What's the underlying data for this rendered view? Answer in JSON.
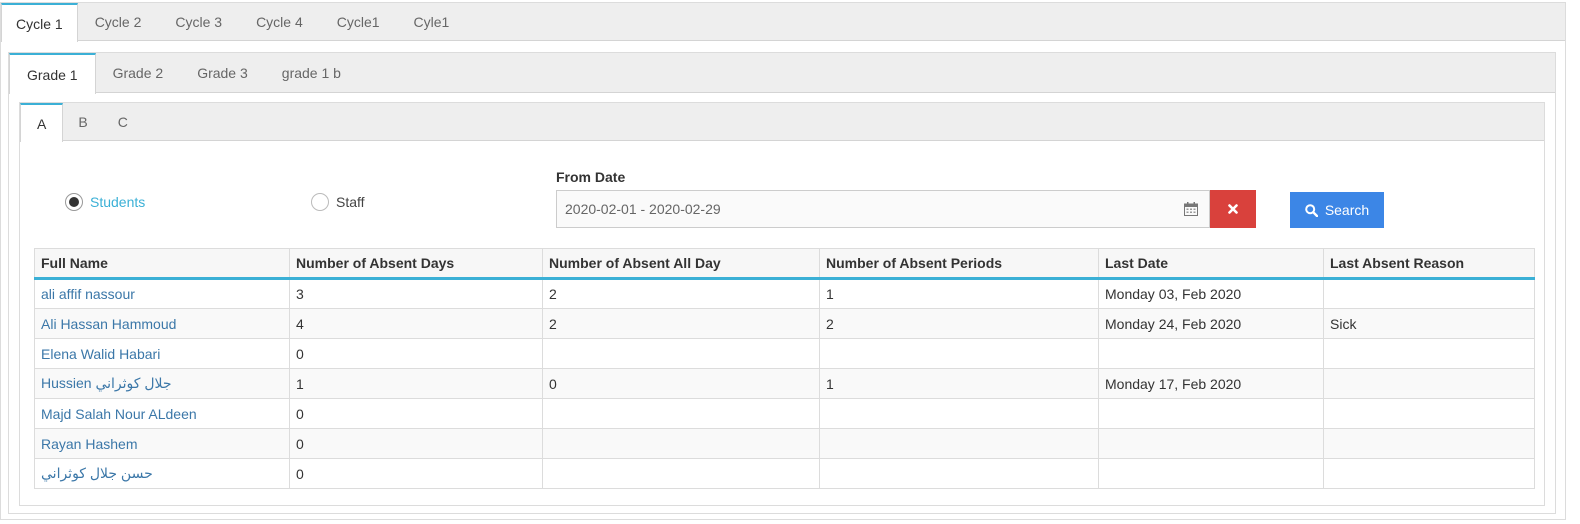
{
  "cycle_tabs": [
    "Cycle 1",
    "Cycle 2",
    "Cycle 3",
    "Cycle 4",
    "Cycle1",
    "Cyle1"
  ],
  "grade_tabs": [
    "Grade 1",
    "Grade 2",
    "Grade 3",
    "grade 1 b"
  ],
  "section_tabs": [
    "A",
    "B",
    "C"
  ],
  "filters": {
    "students_label": "Students",
    "staff_label": "Staff",
    "selected": "Students",
    "from_date_label": "From Date",
    "date_range": "2020-02-01 - 2020-02-29",
    "search_label": "Search"
  },
  "colors": {
    "accent": "#3bb0d6",
    "clear_button": "#d9413c",
    "search_button": "#3c86e6",
    "link": "#3b77a8"
  },
  "icons": {
    "calendar": "calendar-icon",
    "clear": "times-icon",
    "search": "magnifier-icon"
  },
  "table": {
    "headers": [
      "Full Name",
      "Number of Absent Days",
      "Number of Absent All Day",
      "Number of Absent Periods",
      "Last Date",
      "Last Absent Reason"
    ],
    "rows": [
      [
        "ali affif nassour",
        "3",
        "2",
        "1",
        "Monday 03, Feb 2020",
        ""
      ],
      [
        "Ali Hassan Hammoud",
        "4",
        "2",
        "2",
        "Monday 24, Feb 2020",
        "Sick"
      ],
      [
        "Elena Walid Habari",
        "0",
        "",
        "",
        "",
        ""
      ],
      [
        "Hussien جلال كوثراني",
        "1",
        "0",
        "1",
        "Monday 17, Feb 2020",
        ""
      ],
      [
        "Majd Salah Nour ALdeen",
        "0",
        "",
        "",
        "",
        ""
      ],
      [
        "Rayan Hashem",
        "0",
        "",
        "",
        "",
        ""
      ],
      [
        "حسن جلال كوثراني",
        "0",
        "",
        "",
        "",
        ""
      ]
    ]
  }
}
